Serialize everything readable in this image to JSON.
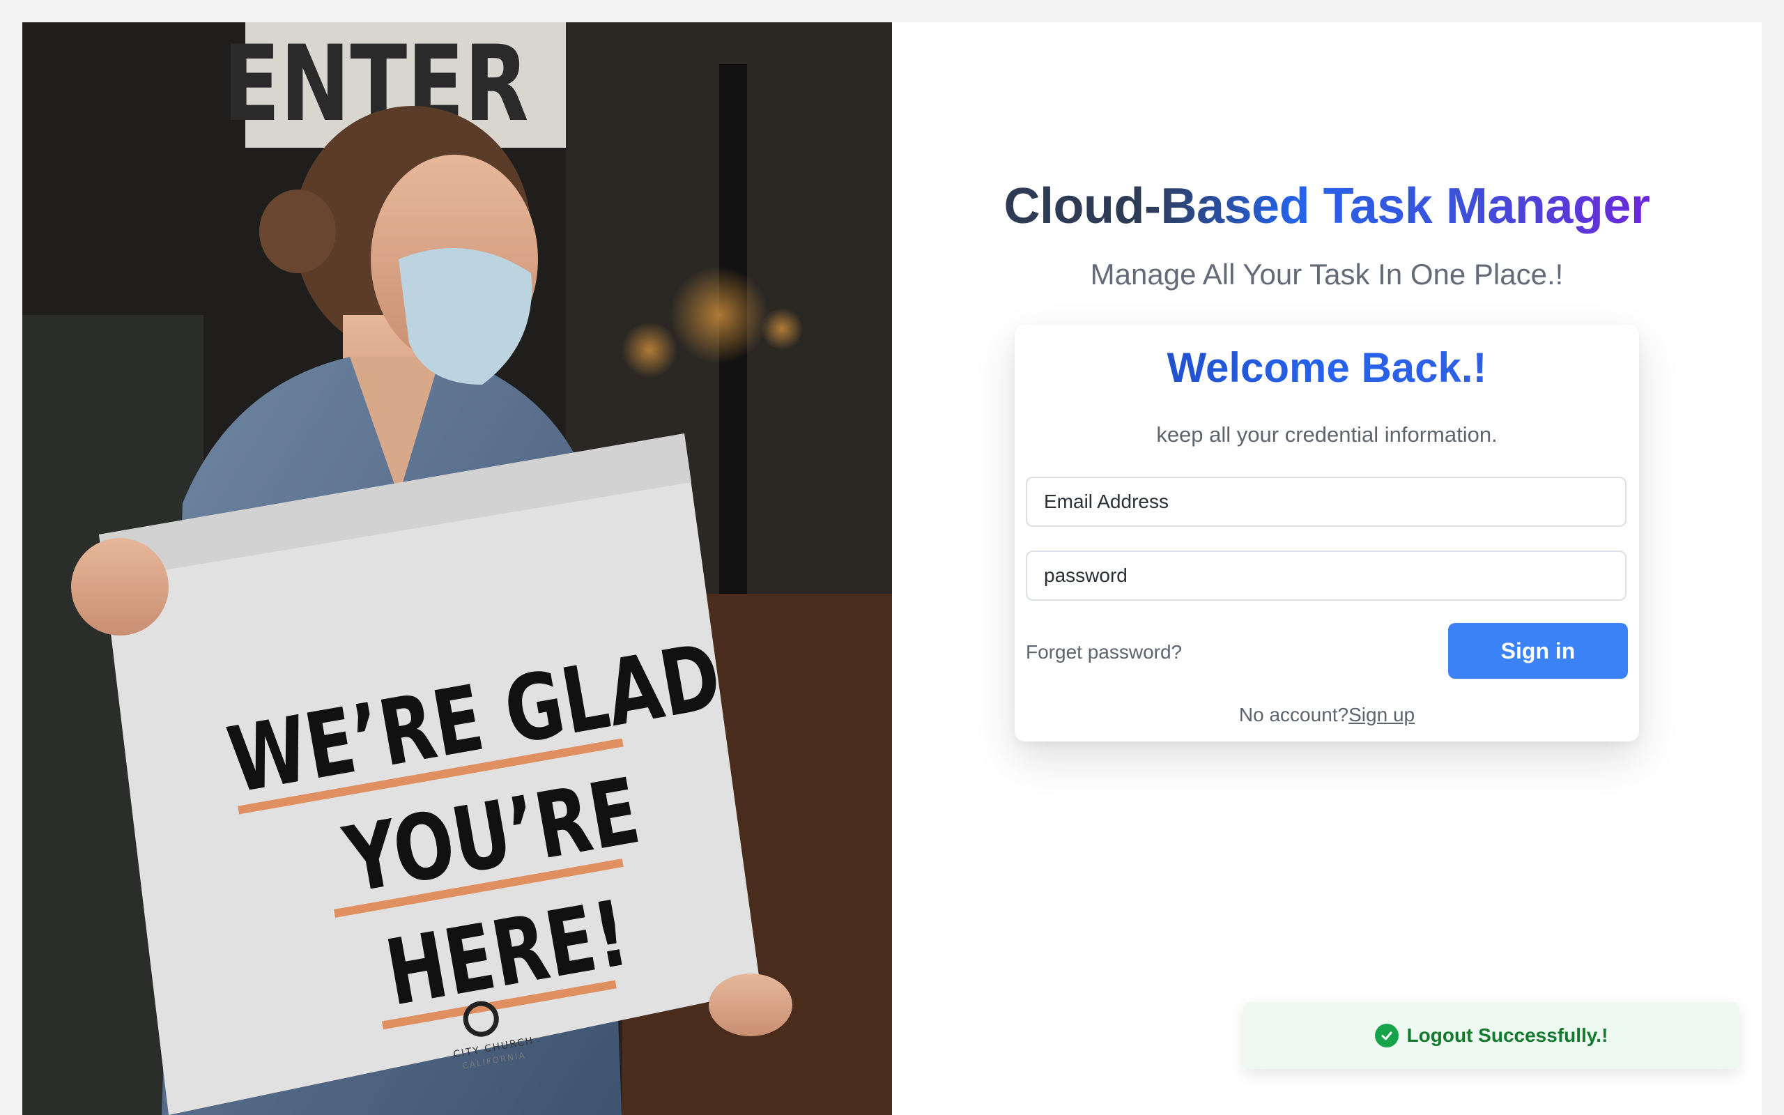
{
  "app": {
    "title_part1": "Cloud-",
    "title_part2": "Based Task Manager",
    "subtitle": "Manage All Your Task In One Place.!"
  },
  "photo": {
    "storefront_sign": "ENTER",
    "placard_line1": "WE’RE GLAD",
    "placard_line2": "YOU’RE",
    "placard_line3": "HERE!",
    "placard_logo_text": "CITY CHURCH",
    "placard_logo_sub": "CALIFORNIA"
  },
  "login": {
    "heading": "Welcome Back.!",
    "subheading": "keep all your credential information.",
    "email_placeholder": "Email Address",
    "password_placeholder": "password",
    "forgot_label": "Forget password?",
    "signin_label": "Sign in",
    "no_account_text": "No account?",
    "signup_label": "Sign up"
  },
  "toast": {
    "message": "Logout Successfully.!",
    "status_color": "#16a34a"
  },
  "colors": {
    "accent_button": "#3b82f6",
    "heading_blue": "#2563eb",
    "title_purple": "#6d28d9"
  }
}
